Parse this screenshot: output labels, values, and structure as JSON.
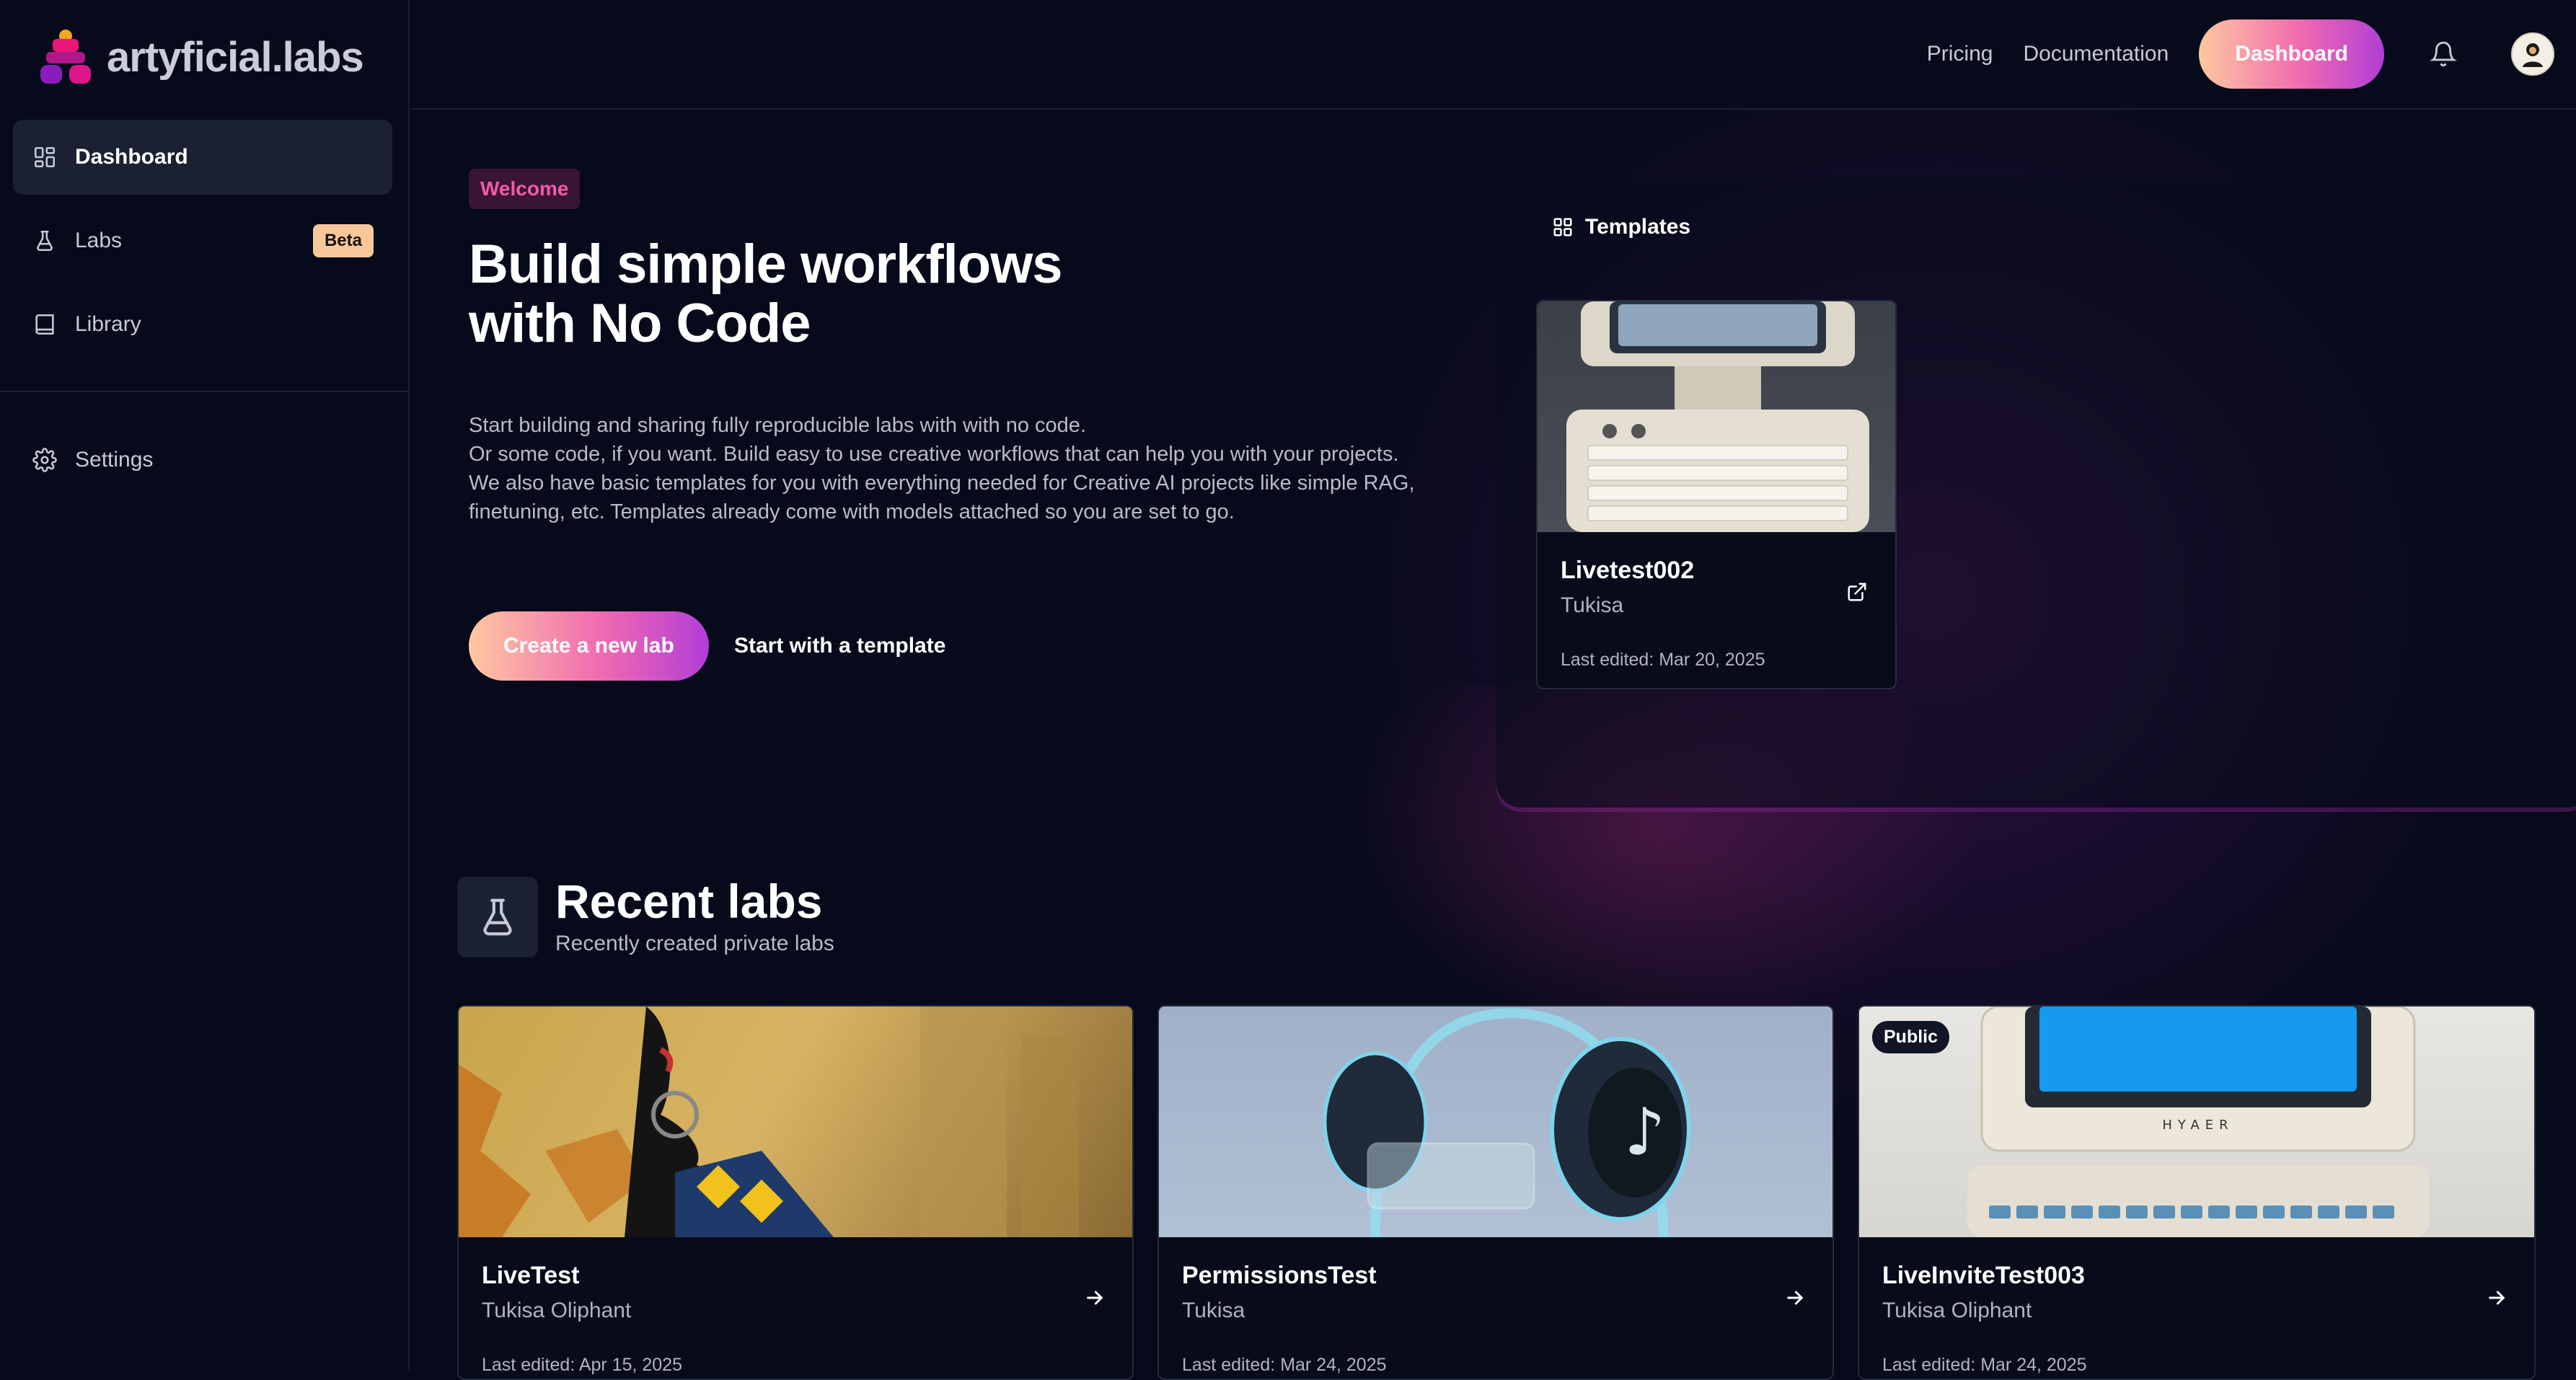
{
  "brand": {
    "name": "artyficial.labs"
  },
  "sidebar": {
    "items": [
      {
        "label": "Dashboard",
        "icon": "dashboard-grid-icon",
        "active": true
      },
      {
        "label": "Labs",
        "icon": "flask-icon",
        "badge": "Beta"
      },
      {
        "label": "Library",
        "icon": "book-icon"
      },
      {
        "label": "Settings",
        "icon": "gear-icon"
      }
    ]
  },
  "topbar": {
    "links": [
      "Pricing",
      "Documentation"
    ],
    "dashboard_button": "Dashboard"
  },
  "hero": {
    "badge": "Welcome",
    "title_line1": "Build simple workflows",
    "title_line2": "with No Code",
    "desc_line1": "Start building and sharing fully reproducible labs with with no code.",
    "desc_line2": "Or some code, if you want. Build easy to use creative workflows that can help you with your projects.",
    "desc_line3": "We also have basic templates for you with everything needed for Creative AI projects like simple RAG,",
    "desc_line4": "finetuning, etc. Templates already come with models attached so you are set to go.",
    "create_button": "Create a new lab",
    "template_button": "Start with a template"
  },
  "templates": {
    "heading": "Templates",
    "cards": [
      {
        "title": "Livetest002",
        "author": "Tukisa",
        "date": "Last edited: Mar 20, 2025"
      }
    ]
  },
  "recent": {
    "title": "Recent labs",
    "subtitle": "Recently created private labs",
    "cards": [
      {
        "title": "LiveTest",
        "author": "Tukisa Oliphant",
        "date": "Last edited: Apr 15, 2025"
      },
      {
        "title": "PermissionsTest",
        "author": "Tukisa",
        "date": "Last edited: Mar 24, 2025"
      },
      {
        "title": "LiveInviteTest003",
        "author": "Tukisa Oliphant",
        "date": "Last edited: Mar 24, 2025",
        "badge": "Public",
        "label": "HYAER"
      }
    ]
  },
  "colors": {
    "background": "#060a1a",
    "accent_gradient_start": "#ffc8a0",
    "accent_gradient_mid": "#f06bb0",
    "accent_gradient_end": "#b03ed6",
    "welcome_pink": "#f25aa8",
    "beta_badge": "#f8c89a"
  }
}
